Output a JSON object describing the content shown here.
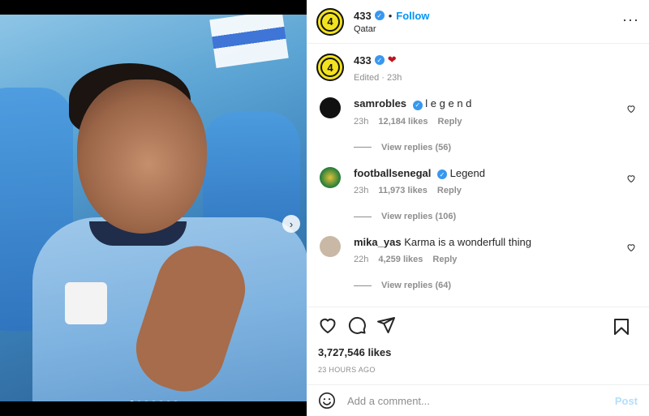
{
  "header": {
    "username": "433",
    "separator": "•",
    "follow_label": "Follow",
    "location": "Qatar",
    "avatar_text": "4",
    "more_icon": "more-horizontal-icon"
  },
  "caption": {
    "username": "433",
    "emoji": "❤",
    "meta": "Edited · 23h"
  },
  "comments": [
    {
      "username": "samrobles",
      "verified": true,
      "text": "l e g e n d",
      "time": "23h",
      "likes": "12,184 likes",
      "reply_label": "Reply",
      "view_replies": "View replies (56)",
      "avatar_color": "#111111"
    },
    {
      "username": "footballsenegal",
      "verified": true,
      "text": "Legend",
      "time": "23h",
      "likes": "11,973 likes",
      "reply_label": "Reply",
      "view_replies": "View replies (106)",
      "avatar_color": "#1e7a3a"
    },
    {
      "username": "mika_yas",
      "verified": false,
      "text": "Karma is a wonderfull thing",
      "time": "22h",
      "likes": "4,259 likes",
      "reply_label": "Reply",
      "view_replies": "View replies (64)",
      "avatar_color": "#c9b8a6"
    }
  ],
  "actions": {
    "icons": [
      "heart-icon",
      "comment-icon",
      "share-icon",
      "bookmark-icon"
    ],
    "likes": "3,727,546 likes",
    "time_ago": "23 HOURS AGO"
  },
  "add_comment": {
    "placeholder": "Add a comment...",
    "post_label": "Post"
  },
  "carousel": {
    "dots": 7,
    "active_index": 0
  },
  "colors": {
    "accent": "#0095f6",
    "verified": "#3897f0",
    "muted": "#8e8e8e",
    "brand_yellow": "#f3e31e"
  }
}
